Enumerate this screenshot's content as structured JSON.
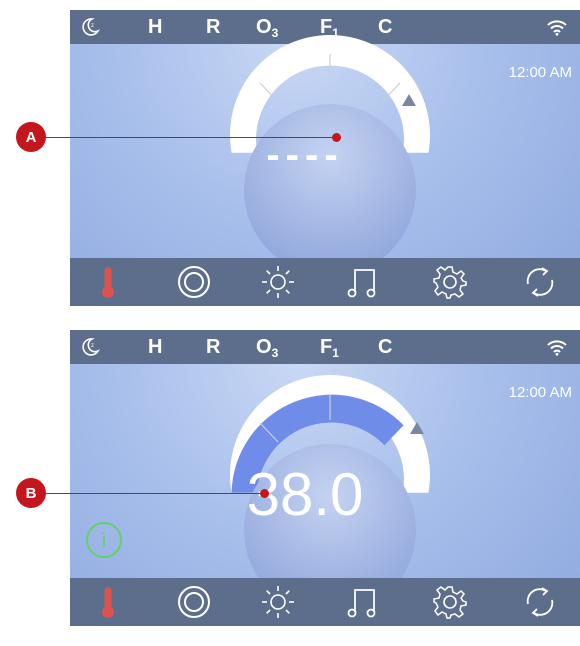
{
  "status_bar": {
    "icons": [
      "moon-sleep-icon",
      "wifi-icon"
    ],
    "indicators": [
      {
        "label": "H"
      },
      {
        "label": "R"
      },
      {
        "label": "O",
        "sub": "3"
      },
      {
        "label": "F",
        "sub": "1"
      },
      {
        "label": "C"
      }
    ]
  },
  "screen_a": {
    "time": "12:00 AM",
    "temp_display": "----"
  },
  "screen_b": {
    "time": "12:00 AM",
    "temp_display": "38.0",
    "info_icon": "i"
  },
  "toolbar": {
    "items": [
      "thermometer-icon",
      "jets-ring-icon",
      "light-sun-icon",
      "music-note-icon",
      "settings-gear-icon",
      "refresh-cycle-icon"
    ]
  },
  "callouts": {
    "a": "A",
    "b": "B"
  },
  "colors": {
    "bar": "#5d6e8c",
    "arc_fill": "#6f8de8",
    "thermometer": "#d9534f",
    "info": "#5fd36a",
    "callout": "#c4161c"
  }
}
